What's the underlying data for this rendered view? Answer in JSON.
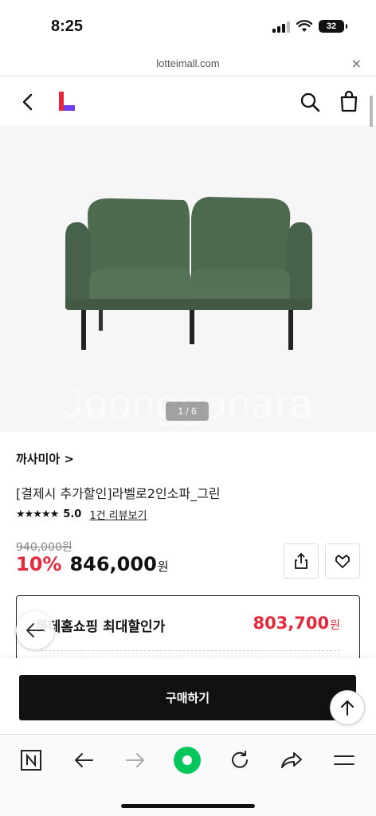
{
  "status_bar": {
    "time": "8:25",
    "battery": "32"
  },
  "url_bar": {
    "domain": "lotteimall.com",
    "close_glyph": "×"
  },
  "header": {
    "logo_letter": "L"
  },
  "gallery": {
    "watermark": "Joonggonara",
    "page_indicator": "1 / 6"
  },
  "product": {
    "brand": "까사미아 >",
    "title": "[결제시 추가할인]라벨로2인소파_그린",
    "stars": "★★★★★",
    "rating": "5.0",
    "review_link": "1건 리뷰보기",
    "original_price": "940,000원",
    "discount_rate": "10%",
    "sale_price": "846,000",
    "currency": "원"
  },
  "promo": {
    "label": "롯데홈쇼핑 최대할인가",
    "price": "803,700",
    "currency": "원"
  },
  "purchase": {
    "buy_label": "구매하기"
  },
  "colors": {
    "accent_red": "#e4293a",
    "logo_red": "#e4293a",
    "logo_purple": "#6f3ee8",
    "sofa_green": "#4e6a4f",
    "naver_green": "#03c75a"
  },
  "icons": [
    "back-icon",
    "lotte-logo",
    "search-icon",
    "shopping-bag-icon",
    "share-icon",
    "heart-icon",
    "arrow-left-icon",
    "arrow-up-icon",
    "naver-n-icon",
    "arrow-right-icon",
    "naver-green-circle-icon",
    "refresh-icon",
    "share-arrow-icon",
    "menu-icon"
  ]
}
